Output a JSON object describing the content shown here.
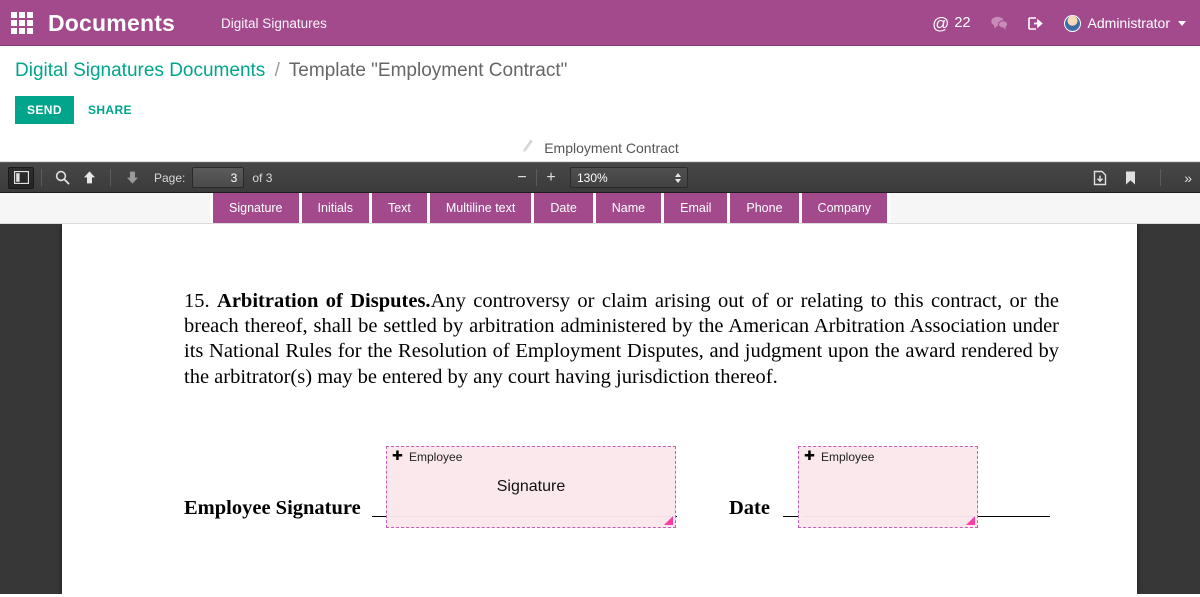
{
  "appbar": {
    "apps_icon": "apps-grid-icon",
    "brand": "Documents",
    "menu": "Digital Signatures",
    "mentions_at": "@",
    "mentions_count": "22",
    "chat_icon": "chat-bubble-icon",
    "login_icon": "sign-in-icon",
    "user": "Administrator",
    "bg_color": "#a24a8c"
  },
  "breadcrumb": {
    "parent": "Digital Signatures Documents",
    "separator": "/",
    "current": "Template \"Employment Contract\""
  },
  "actions": {
    "send_label": "SEND",
    "share_label": "SHARE",
    "accent_color": "#00a58b"
  },
  "document": {
    "title": "Employment Contract",
    "edit_icon": "pencil-icon"
  },
  "pdf_toolbar": {
    "sidebar_toggle_icon": "sidebar-toggle-icon",
    "find_icon": "search-icon",
    "prev_page_icon": "arrow-up-icon",
    "next_page_icon": "arrow-down-icon",
    "page_label": "Page:",
    "page_value": "3",
    "page_total": "of 3",
    "zoom_out_label": "−",
    "zoom_in_label": "+",
    "zoom_level": "130%",
    "download_icon": "download-icon",
    "bookmark_icon": "bookmark-icon",
    "more_tools_label": "»"
  },
  "field_buttons": [
    {
      "label": "Signature"
    },
    {
      "label": "Initials"
    },
    {
      "label": "Text"
    },
    {
      "label": "Multiline text"
    },
    {
      "label": "Date"
    },
    {
      "label": "Name"
    },
    {
      "label": "Email"
    },
    {
      "label": "Phone"
    },
    {
      "label": "Company"
    }
  ],
  "page_content": {
    "clause_number": "15.",
    "clause_heading": "Arbitration of Disputes.",
    "clause_body": "Any controversy or claim arising out of or relating to this contract, or the breach thereof, shall be settled by arbitration administered by the American Arbitration Association under its National Rules for the Resolution of Employment Disputes, and judgment upon the award rendered by the arbitrator(s) may be entered by any court having jurisdiction thereof.",
    "signature_label": "Employee Signature",
    "date_label": "Date"
  },
  "fields": [
    {
      "name": "signature-field",
      "role": "Employee",
      "value": "Signature",
      "move_icon": "move-icon",
      "resize_icon": "resize-handle-icon",
      "fill_color": "#fbe8ec",
      "border_color": "#c060b4",
      "handle_color": "#ff3ea5"
    },
    {
      "name": "date-field",
      "role": "Employee",
      "value": "",
      "move_icon": "move-icon",
      "resize_icon": "resize-handle-icon",
      "fill_color": "#fbe8ec",
      "border_color": "#c060b4",
      "handle_color": "#ff3ea5"
    }
  ]
}
